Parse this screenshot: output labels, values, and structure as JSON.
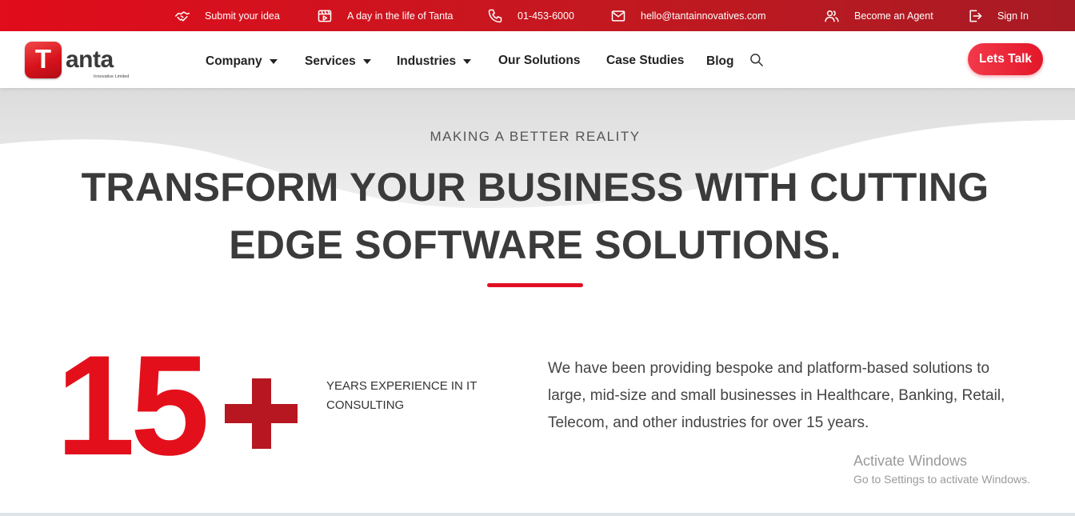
{
  "topbar": {
    "items": [
      {
        "label": "Submit your idea",
        "icon": "handshake-icon"
      },
      {
        "label": "A day in the life of Tanta",
        "icon": "video-icon"
      },
      {
        "label": "01-453-6000",
        "icon": "phone-icon"
      },
      {
        "label": "hello@tantainnovatives.com",
        "icon": "mail-icon"
      },
      {
        "label": "Become an Agent",
        "icon": "user-group-icon"
      },
      {
        "label": "Sign In",
        "icon": "sign-in-icon"
      }
    ]
  },
  "logo": {
    "mark": "T",
    "word": "anta",
    "tagline": "Innovative Limited"
  },
  "nav": {
    "items": [
      {
        "label": "Company",
        "dropdown": true
      },
      {
        "label": "Services",
        "dropdown": true
      },
      {
        "label": "Industries",
        "dropdown": true
      },
      {
        "label": "Our Solutions",
        "dropdown": false
      },
      {
        "label": "Case Studies",
        "dropdown": false
      },
      {
        "label": "Blog",
        "dropdown": false
      }
    ],
    "cta": "Lets Talk"
  },
  "hero": {
    "eyebrow": "MAKING A BETTER REALITY",
    "headline_line1": "TRANSFORM YOUR BUSINESS WITH CUTTING",
    "headline_line2": "EDGE SOFTWARE SOLUTIONS."
  },
  "stats": {
    "number": "15",
    "suffix": "+",
    "caption": "YEARS EXPERIENCE IN IT CONSULTING",
    "paragraph": "We have been providing bespoke and platform-based solutions to large, mid-size and small businesses in Healthcare, Banking, Retail, Telecom, and other industries for over 15 years."
  },
  "watermark": {
    "title": "Activate Windows",
    "subtitle": "Go to Settings to activate Windows."
  },
  "colors": {
    "brand_red": "#e3101c",
    "dark_red": "#b71720",
    "text_dark": "#3b3b3b"
  }
}
